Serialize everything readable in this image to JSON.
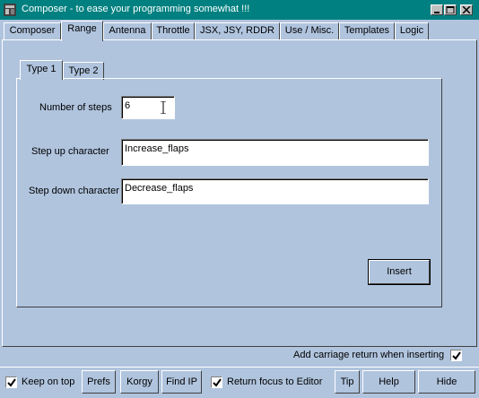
{
  "window": {
    "title": "Composer - to ease your programming somewhat !!!",
    "app_icon": "composer-app-icon",
    "controls": [
      "minimize-icon",
      "maximize-icon",
      "close-icon"
    ]
  },
  "tabs": [
    {
      "label": "Composer",
      "active": false
    },
    {
      "label": "Range",
      "active": true
    },
    {
      "label": "Antenna",
      "active": false
    },
    {
      "label": "Throttle",
      "active": false
    },
    {
      "label": "JSX, JSY, RDDR",
      "active": false
    },
    {
      "label": "Use / Misc.",
      "active": false
    },
    {
      "label": "Templates",
      "active": false
    },
    {
      "label": "Logic",
      "active": false
    }
  ],
  "subtabs": [
    {
      "label": "Type 1",
      "active": true
    },
    {
      "label": "Type 2",
      "active": false
    }
  ],
  "form": {
    "steps_label": "Number of steps",
    "steps_value": "6",
    "step_up_label": "Step up character",
    "step_up_value": "Increase_flaps",
    "step_down_label": "Step down character",
    "step_down_value": "Decrease_flaps",
    "insert_label": "Insert"
  },
  "options": {
    "carriage_return_label": "Add carriage return when inserting",
    "carriage_return_checked": true
  },
  "bottom_bar": {
    "keep_on_top_label": "Keep on top",
    "keep_on_top_checked": true,
    "prefs_label": "Prefs",
    "korgy_label": "Korgy",
    "find_ip_label": "Find IP",
    "return_focus_label": "Return focus to Editor",
    "return_focus_checked": true,
    "tip_label": "Tip",
    "help_label": "Help",
    "hide_label": "Hide"
  },
  "colors": {
    "titlebar": "#008080",
    "face": "#b0c4de"
  }
}
